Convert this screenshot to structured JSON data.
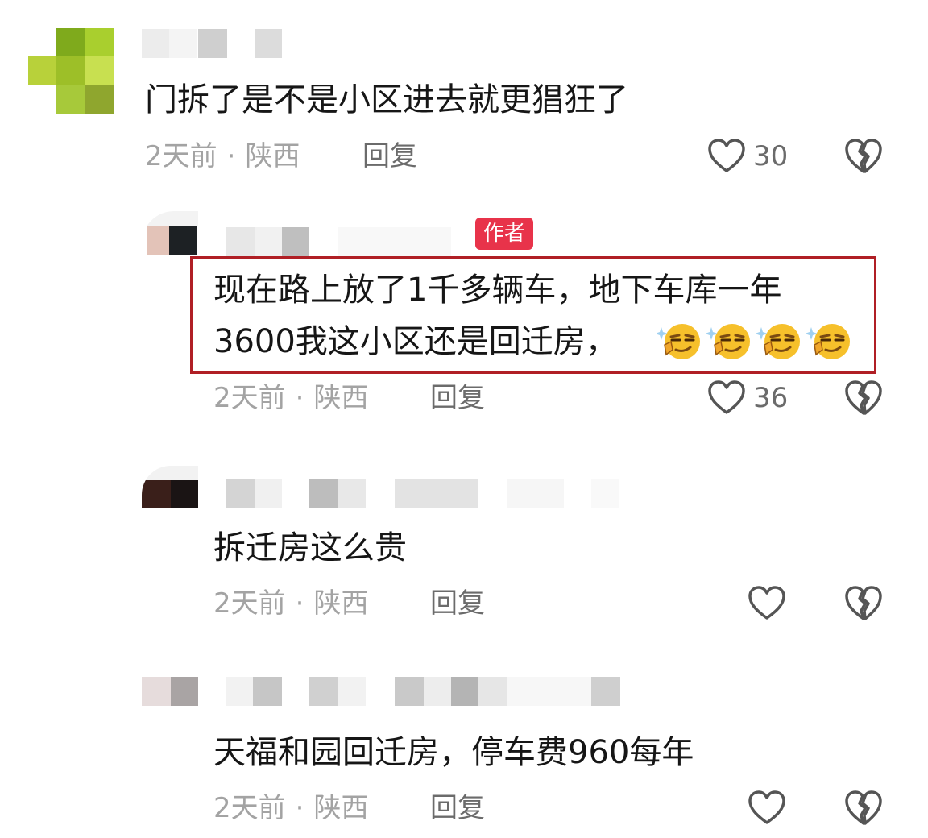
{
  "comments": [
    {
      "text": "门拆了是不是小区进去就更猖狂了",
      "time": "2天前",
      "location": "陕西",
      "reply_label": "回复",
      "likes": "30"
    },
    {
      "author_tag": "作者",
      "text_line1": "现在路上放了1千多辆车，地下车库一年",
      "text_line2": "3600我这小区还是回迁房，",
      "emoji_name": "smirk-face",
      "time": "2天前",
      "location": "陕西",
      "reply_label": "回复",
      "likes": "36"
    },
    {
      "text": "拆迁房这么贵",
      "time": "2天前",
      "location": "陕西",
      "reply_label": "回复",
      "likes": ""
    },
    {
      "text": "天福和园回迁房，停车费960每年",
      "time": "2天前",
      "location": "陕西",
      "reply_label": "回复",
      "likes": ""
    }
  ],
  "separator": "·",
  "icons": {
    "like": "heart-outline-icon",
    "dislike": "broken-heart-icon"
  },
  "colors": {
    "author_tag_bg": "#e8334a",
    "highlight_border": "#b01f25",
    "meta_text": "#a3a3a3"
  }
}
